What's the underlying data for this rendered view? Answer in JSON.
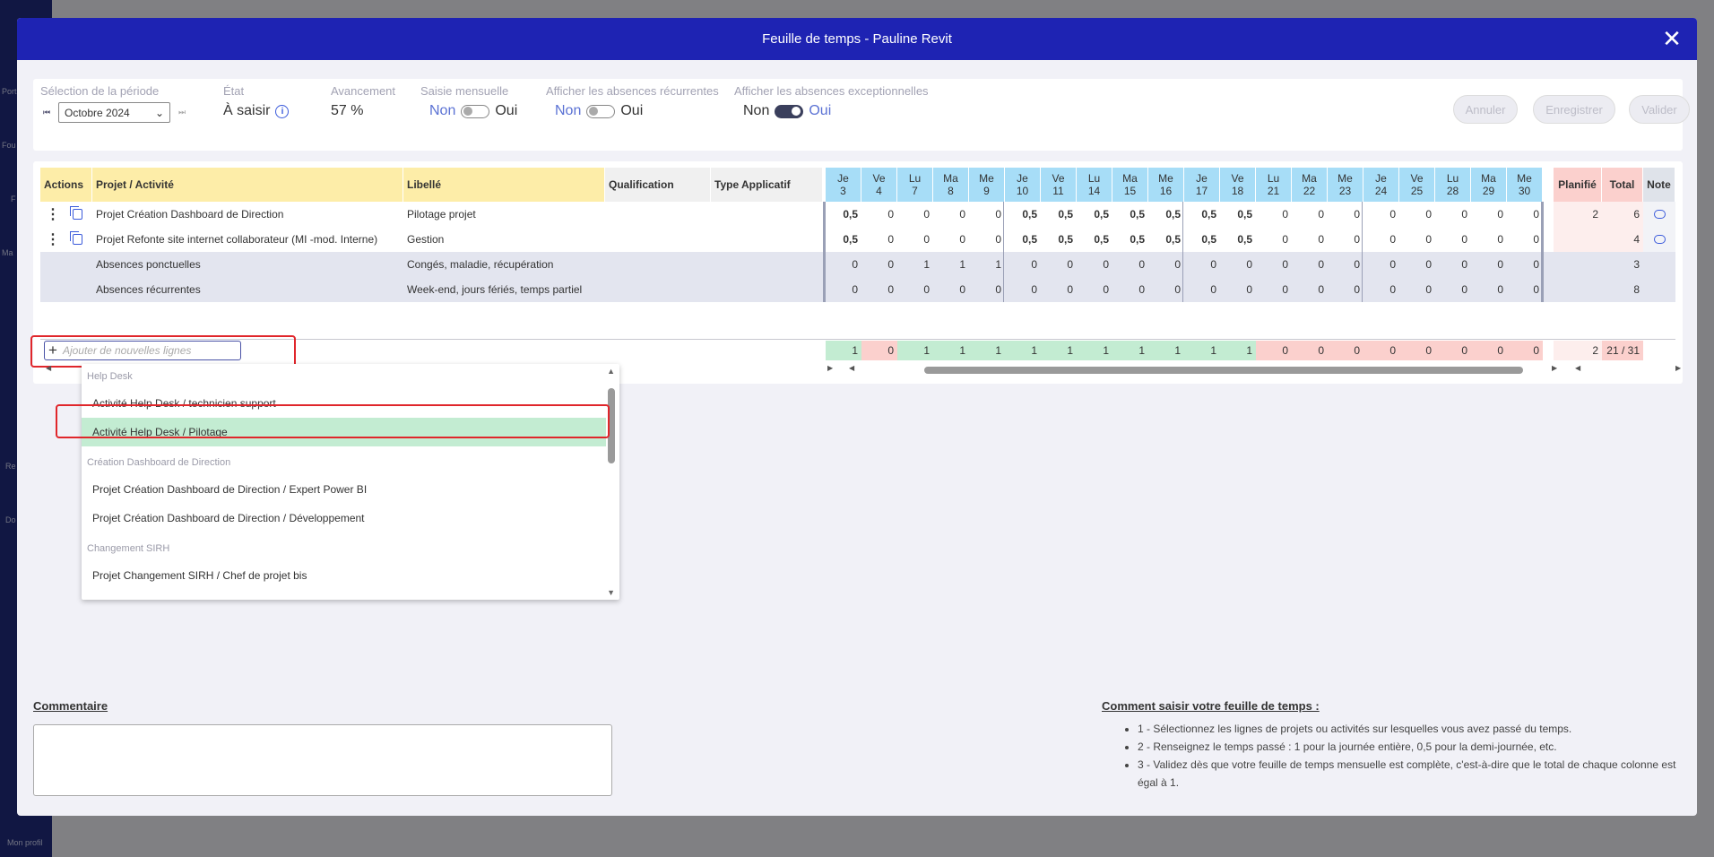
{
  "background": {
    "nav_labels": [
      "Port",
      "Fou",
      "F",
      "Ma",
      "Re",
      "Do",
      "Mon profil"
    ]
  },
  "modal": {
    "title": "Feuille de temps - Pauline Revit",
    "close_label": "✕"
  },
  "controls": {
    "period_label": "Sélection de la période",
    "period_value": "Octobre 2024",
    "state_label": "État",
    "state_value": "À saisir",
    "progress_label": "Avancement",
    "progress_value": "57 %",
    "monthly_label": "Saisie mensuelle",
    "recurring_label": "Afficher les absences récurrentes",
    "exceptional_label": "Afficher les absences exceptionnelles",
    "non": "Non",
    "oui": "Oui",
    "monthly_on": false,
    "recurring_on": false,
    "exceptional_on": true,
    "cancel_button": "Annuler",
    "save_button": "Enregistrer",
    "validate_button": "Valider"
  },
  "grid": {
    "headers": {
      "actions": "Actions",
      "project": "Projet / Activité",
      "label": "Libellé",
      "qualification": "Qualification",
      "type": "Type Applicatif",
      "planned": "Planifié",
      "total": "Total",
      "note": "Note"
    },
    "days": [
      {
        "d": "Je",
        "n": "3"
      },
      {
        "d": "Ve",
        "n": "4"
      },
      {
        "d": "Lu",
        "n": "7"
      },
      {
        "d": "Ma",
        "n": "8"
      },
      {
        "d": "Me",
        "n": "9"
      },
      {
        "d": "Je",
        "n": "10"
      },
      {
        "d": "Ve",
        "n": "11"
      },
      {
        "d": "Lu",
        "n": "14"
      },
      {
        "d": "Ma",
        "n": "15"
      },
      {
        "d": "Me",
        "n": "16"
      },
      {
        "d": "Je",
        "n": "17"
      },
      {
        "d": "Ve",
        "n": "18"
      },
      {
        "d": "Lu",
        "n": "21"
      },
      {
        "d": "Ma",
        "n": "22"
      },
      {
        "d": "Me",
        "n": "23"
      },
      {
        "d": "Je",
        "n": "24"
      },
      {
        "d": "Ve",
        "n": "25"
      },
      {
        "d": "Lu",
        "n": "28"
      },
      {
        "d": "Ma",
        "n": "29"
      },
      {
        "d": "Me",
        "n": "30"
      }
    ],
    "rows": [
      {
        "project": "Projet Création Dashboard de Direction",
        "label": "Pilotage projet",
        "values": [
          "0,5",
          "0",
          "0",
          "0",
          "0",
          "0,5",
          "0,5",
          "0,5",
          "0,5",
          "0,5",
          "0,5",
          "0,5",
          "0",
          "0",
          "0",
          "0",
          "0",
          "0",
          "0",
          "0"
        ],
        "planned": "2",
        "total": "6",
        "has_actions": true
      },
      {
        "project": "Projet Refonte site internet collaborateur (MI -mod. Interne)",
        "label": "Gestion",
        "values": [
          "0,5",
          "0",
          "0",
          "0",
          "0",
          "0,5",
          "0,5",
          "0,5",
          "0,5",
          "0,5",
          "0,5",
          "0,5",
          "0",
          "0",
          "0",
          "0",
          "0",
          "0",
          "0",
          "0"
        ],
        "planned": "",
        "total": "4",
        "has_actions": true
      },
      {
        "project": "Absences ponctuelles",
        "label": "Congés, maladie, récupération",
        "values": [
          "0",
          "0",
          "1",
          "1",
          "1",
          "0",
          "0",
          "0",
          "0",
          "0",
          "0",
          "0",
          "0",
          "0",
          "0",
          "0",
          "0",
          "0",
          "0",
          "0"
        ],
        "planned": "",
        "total": "3",
        "has_actions": false
      },
      {
        "project": "Absences récurrentes",
        "label": "Week-end, jours fériés, temps partiel",
        "values": [
          "0",
          "0",
          "0",
          "0",
          "0",
          "0",
          "0",
          "0",
          "0",
          "0",
          "0",
          "0",
          "0",
          "0",
          "0",
          "0",
          "0",
          "0",
          "0",
          "0"
        ],
        "planned": "",
        "total": "8",
        "has_actions": false
      }
    ],
    "totals": [
      "1",
      "0",
      "1",
      "1",
      "1",
      "1",
      "1",
      "1",
      "1",
      "1",
      "1",
      "1",
      "0",
      "0",
      "0",
      "0",
      "0",
      "0",
      "0",
      "0"
    ],
    "totals_planned": "2",
    "totals_total": "21 / 31",
    "add_placeholder": "Ajouter de nouvelles lignes"
  },
  "dropdown": {
    "entries": [
      {
        "kind": "group",
        "text": "Help Desk"
      },
      {
        "kind": "item",
        "text": "Activité Help Desk / technicien support"
      },
      {
        "kind": "item",
        "text": "Activité Help Desk / Pilotage",
        "selected": true
      },
      {
        "kind": "group",
        "text": "Création Dashboard de Direction"
      },
      {
        "kind": "item",
        "text": "Projet Création Dashboard de Direction / Expert Power BI"
      },
      {
        "kind": "item",
        "text": "Projet Création Dashboard de Direction / Développement"
      },
      {
        "kind": "group",
        "text": "Changement SIRH"
      },
      {
        "kind": "item",
        "text": "Projet Changement SIRH / Chef de projet bis"
      }
    ]
  },
  "comment": {
    "label": "Commentaire",
    "value": ""
  },
  "help": {
    "title": "Comment saisir votre feuille de temps :",
    "steps": [
      "1 - Sélectionnez les lignes de projets ou activités sur lesquelles vous avez passé du temps.",
      "2 - Renseignez le temps passé : 1 pour la journée entière, 0,5 pour la demi-journée, etc.",
      "3 - Validez dès que votre feuille de temps mensuelle est complète, c'est-à-dire que le total de chaque colonne est égal à 1."
    ]
  },
  "colors": {
    "header_blue": "#1e23b3",
    "day_blue": "#a7ddf7",
    "yellow": "#fdeda8",
    "total_green": "#c3ecd2",
    "total_red": "#fbd0cd",
    "highlight_red": "#e0262b"
  }
}
